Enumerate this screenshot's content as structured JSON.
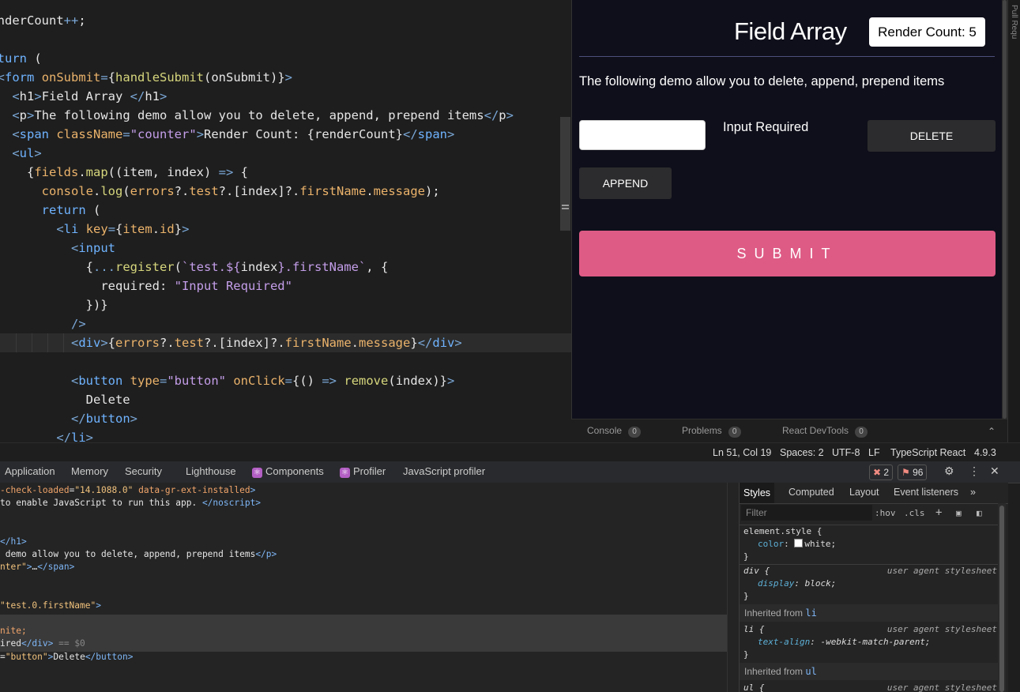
{
  "editor": {
    "lines": [
      [
        [
          "t",
          "renderCount"
        ],
        [
          "o",
          "++"
        ],
        [
          "t",
          ";"
        ]
      ],
      [],
      [
        [
          "k",
          "return"
        ],
        [
          "t",
          " ("
        ]
      ],
      [
        [
          "t",
          "  "
        ],
        [
          "o",
          "<"
        ],
        [
          "k",
          "form"
        ],
        [
          "t",
          " "
        ],
        [
          "a",
          "onSubmit"
        ],
        [
          "o",
          "="
        ],
        [
          "t",
          "{"
        ],
        [
          "f",
          "handleSubmit"
        ],
        [
          "t",
          "(onSubmit)}"
        ],
        [
          "o",
          ">"
        ]
      ],
      [
        [
          "t",
          "    "
        ],
        [
          "o",
          "<"
        ],
        [
          "t",
          "h1"
        ],
        [
          "o",
          ">"
        ],
        [
          "t",
          "Field Array "
        ],
        [
          "o",
          "</"
        ],
        [
          "t",
          "h1"
        ],
        [
          "o",
          ">"
        ]
      ],
      [
        [
          "t",
          "    "
        ],
        [
          "o",
          "<"
        ],
        [
          "t",
          "p"
        ],
        [
          "o",
          ">"
        ],
        [
          "t",
          "The following demo allow you to delete, append, prepend items"
        ],
        [
          "o",
          "</"
        ],
        [
          "t",
          "p"
        ],
        [
          "o",
          ">"
        ]
      ],
      [
        [
          "t",
          "    "
        ],
        [
          "o",
          "<"
        ],
        [
          "k",
          "span"
        ],
        [
          "t",
          " "
        ],
        [
          "a",
          "className"
        ],
        [
          "o",
          "="
        ],
        [
          "s",
          "\"counter\""
        ],
        [
          "o",
          ">"
        ],
        [
          "t",
          "Render Count: {renderCount}"
        ],
        [
          "o",
          "</"
        ],
        [
          "k",
          "span"
        ],
        [
          "o",
          ">"
        ]
      ],
      [
        [
          "t",
          "    "
        ],
        [
          "o",
          "<"
        ],
        [
          "k",
          "ul"
        ],
        [
          "o",
          ">"
        ]
      ],
      [
        [
          "t",
          "      {"
        ],
        [
          "a",
          "fields"
        ],
        [
          "t",
          "."
        ],
        [
          "f",
          "map"
        ],
        [
          "t",
          "((item, index) "
        ],
        [
          "o",
          "=>"
        ],
        [
          "t",
          " {"
        ]
      ],
      [
        [
          "t",
          "        "
        ],
        [
          "a",
          "console"
        ],
        [
          "t",
          "."
        ],
        [
          "f",
          "log"
        ],
        [
          "t",
          "("
        ],
        [
          "a",
          "errors"
        ],
        [
          "t",
          "?."
        ],
        [
          "a",
          "test"
        ],
        [
          "t",
          "?.[index]?."
        ],
        [
          "a",
          "firstName"
        ],
        [
          "t",
          "."
        ],
        [
          "a",
          "message"
        ],
        [
          "t",
          ");"
        ]
      ],
      [
        [
          "t",
          "        "
        ],
        [
          "k",
          "return"
        ],
        [
          "t",
          " ("
        ]
      ],
      [
        [
          "t",
          "          "
        ],
        [
          "o",
          "<"
        ],
        [
          "k",
          "li"
        ],
        [
          "t",
          " "
        ],
        [
          "a",
          "key"
        ],
        [
          "o",
          "="
        ],
        [
          "t",
          "{"
        ],
        [
          "a",
          "item"
        ],
        [
          "t",
          "."
        ],
        [
          "a",
          "id"
        ],
        [
          "t",
          "}"
        ],
        [
          "o",
          ">"
        ]
      ],
      [
        [
          "t",
          "            "
        ],
        [
          "o",
          "<"
        ],
        [
          "k",
          "input"
        ]
      ],
      [
        [
          "t",
          "              {"
        ],
        [
          "o",
          "..."
        ],
        [
          "f",
          "register"
        ],
        [
          "t",
          "("
        ],
        [
          "s",
          "`test.${"
        ],
        [
          "t",
          "index"
        ],
        [
          "s",
          "}.firstName`"
        ],
        [
          "t",
          ", {"
        ]
      ],
      [
        [
          "t",
          "                "
        ],
        [
          "t",
          "required: "
        ],
        [
          "s",
          "\"Input Required\""
        ]
      ],
      [
        [
          "t",
          "              })}"
        ]
      ],
      [
        [
          "t",
          "            "
        ],
        [
          "o",
          "/>"
        ]
      ],
      [
        [
          "t",
          "            "
        ],
        [
          "o",
          "<"
        ],
        [
          "k",
          "div"
        ],
        [
          "o",
          ">"
        ],
        [
          "t",
          "{"
        ],
        [
          "a",
          "errors"
        ],
        [
          "t",
          "?."
        ],
        [
          "a",
          "test"
        ],
        [
          "t",
          "?.[index]?."
        ],
        [
          "a",
          "firstName"
        ],
        [
          "t",
          "."
        ],
        [
          "a",
          "message"
        ],
        [
          "t",
          "}"
        ],
        [
          "o",
          "</"
        ],
        [
          "k",
          "div"
        ],
        [
          "o",
          ">"
        ]
      ],
      [],
      [
        [
          "t",
          "            "
        ],
        [
          "o",
          "<"
        ],
        [
          "k",
          "button"
        ],
        [
          "t",
          " "
        ],
        [
          "a",
          "type"
        ],
        [
          "o",
          "="
        ],
        [
          "s",
          "\"button\""
        ],
        [
          "t",
          " "
        ],
        [
          "a",
          "onClick"
        ],
        [
          "o",
          "="
        ],
        [
          "t",
          "{() "
        ],
        [
          "o",
          "=>"
        ],
        [
          "t",
          " "
        ],
        [
          "f",
          "remove"
        ],
        [
          "t",
          "(index)}"
        ],
        [
          "o",
          ">"
        ]
      ],
      [
        [
          "t",
          "              Delete"
        ]
      ],
      [
        [
          "t",
          "            "
        ],
        [
          "o",
          "</"
        ],
        [
          "k",
          "button"
        ],
        [
          "o",
          ">"
        ]
      ],
      [
        [
          "t",
          "          "
        ],
        [
          "o",
          "</"
        ],
        [
          "k",
          "li"
        ],
        [
          "o",
          ">"
        ]
      ]
    ]
  },
  "preview": {
    "title": "Field Array",
    "counter": "Render Count: 5",
    "paragraph": "The following demo allow you to delete, append, prepend items",
    "input_value": "",
    "error_text": "Input Required",
    "delete_label": "DELETE",
    "append_label": "APPEND",
    "submit_label": "SUBMIT"
  },
  "side_tab": "Pull Requ",
  "panel_tabs": [
    {
      "label": "Console",
      "count": "0"
    },
    {
      "label": "Problems",
      "count": "0"
    },
    {
      "label": "React DevTools",
      "count": "0"
    }
  ],
  "statusbar": {
    "position": "Ln 51, Col 19",
    "spaces": "Spaces: 2",
    "encoding": "UTF-8",
    "eol": "LF",
    "language": "TypeScript React",
    "version": "4.9.3"
  },
  "devtools": {
    "tabs": [
      "Application",
      "Memory",
      "Security",
      "Lighthouse",
      "Components",
      "Profiler",
      "JavaScript profiler"
    ],
    "errors": "2",
    "warnings": "96",
    "elements": [
      [
        [
          "an",
          "-check-loaded"
        ],
        [
          "t",
          "="
        ],
        [
          "av",
          "\"14.1088.0\""
        ],
        [
          "t",
          " "
        ],
        [
          "an",
          "data-gr-ext-installed"
        ],
        [
          "tg",
          ">"
        ]
      ],
      [
        [
          "t",
          "to enable JavaScript to run this app. "
        ],
        [
          "tg",
          "</noscript>"
        ]
      ],
      [],
      [],
      [
        [
          "tg",
          "</h1>"
        ]
      ],
      [
        [
          "t",
          " demo allow you to delete, append, prepend items"
        ],
        [
          "tg",
          "</p>"
        ]
      ],
      [
        [
          "av",
          "nter\""
        ],
        [
          "tg",
          ">"
        ],
        [
          "t",
          "…"
        ],
        [
          "tg",
          "</span>"
        ]
      ],
      [],
      [],
      [
        [
          "av",
          "\"test.0.firstName\""
        ],
        [
          "tg",
          ">"
        ]
      ],
      [],
      [
        [
          "an",
          "nite;"
        ]
      ],
      [
        [
          "t",
          "ired"
        ],
        [
          "tg",
          "</div>"
        ],
        [
          "dim",
          " == $0"
        ]
      ],
      [
        [
          "t",
          "="
        ],
        [
          "av",
          "\"button\""
        ],
        [
          "tg",
          ">"
        ],
        [
          "t",
          "Delete"
        ],
        [
          "tg",
          "</button>"
        ]
      ]
    ],
    "styles_tabs": [
      "Styles",
      "Computed",
      "Layout",
      "Event listeners"
    ],
    "filter_placeholder": "Filter",
    "hov": ":hov",
    "cls": ".cls",
    "rules": {
      "element_style": "element.style {",
      "color_prop": "color",
      "color_val": "white;",
      "div_sel": "div {",
      "div_prop": "display",
      "div_val": "block;",
      "ua": "user agent stylesheet",
      "inherited_li": "Inherited from",
      "li_tag": "li",
      "li_sel": "li {",
      "li_prop": "text-align",
      "li_val": "-webkit-match-parent;",
      "inherited_ul": "Inherited from",
      "ul_tag": "ul",
      "ul_sel": "ul {",
      "close": "}"
    }
  }
}
